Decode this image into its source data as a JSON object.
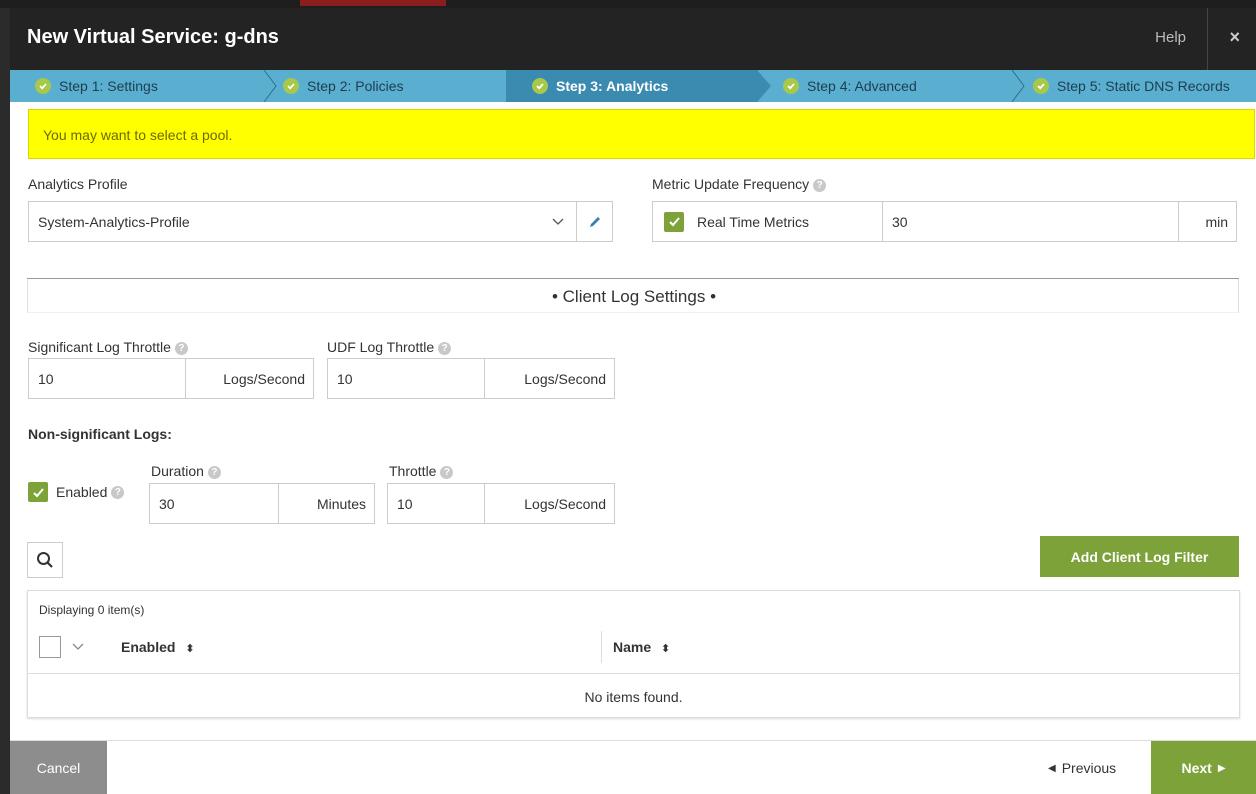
{
  "window": {
    "title": "New Virtual Service: g-dns",
    "help_label": "Help",
    "close_label": "×"
  },
  "wizard": {
    "steps": [
      {
        "label": "Step 1: Settings"
      },
      {
        "label": "Step 2: Policies"
      },
      {
        "label": "Step 3: Analytics"
      },
      {
        "label": "Step 4: Advanced"
      },
      {
        "label": "Step 5: Static DNS Records"
      }
    ]
  },
  "alert": {
    "message": "You may want to select a pool."
  },
  "analytics_profile": {
    "label": "Analytics Profile",
    "value": "System-Analytics-Profile"
  },
  "metric_update": {
    "label": "Metric Update Frequency",
    "checkbox_label": "Real Time Metrics",
    "value": "30",
    "unit": "min"
  },
  "client_log_section": {
    "title": "• Client Log Settings •"
  },
  "significant_log_throttle": {
    "label": "Significant Log Throttle",
    "value": "10",
    "unit": "Logs/Second"
  },
  "udf_log_throttle": {
    "label": "UDF Log Throttle",
    "value": "10",
    "unit": "Logs/Second"
  },
  "non_significant": {
    "heading": "Non-significant Logs:",
    "enabled_label": "Enabled",
    "duration_label": "Duration",
    "duration_value": "30",
    "duration_unit": "Minutes",
    "throttle_label": "Throttle",
    "throttle_value": "10",
    "throttle_unit": "Logs/Second"
  },
  "filters": {
    "add_button": "Add Client Log Filter",
    "displaying": "Displaying 0 item(s)",
    "columns": [
      "Enabled",
      "Name"
    ],
    "empty": "No items found."
  },
  "footer": {
    "cancel": "Cancel",
    "previous": "Previous",
    "next": "Next"
  },
  "colors": {
    "accent_green": "#7da23a",
    "step_bar": "#5aafd0",
    "step_active": "#3b8ab0",
    "alert_bg": "#ffff00",
    "header_bg": "#232323"
  }
}
